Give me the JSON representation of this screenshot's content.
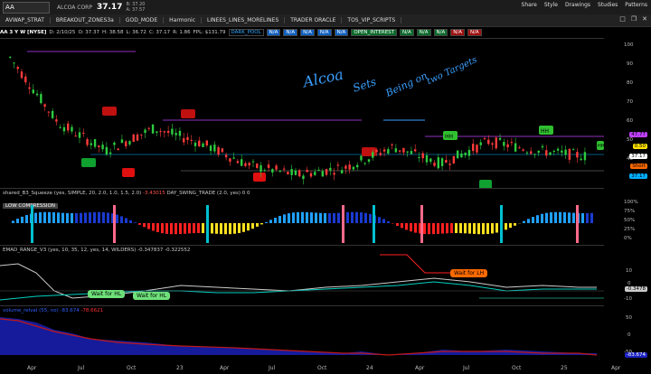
{
  "topbar": {
    "symbol": "AA",
    "company": "ALCOA CORP",
    "price": "37.17",
    "bid": "B: 37.20",
    "ask": "A: 37.57",
    "menu": [
      "Share",
      "Style",
      "Drawings",
      "Studies",
      "Patterns"
    ]
  },
  "studies_tabs": [
    "AVWAP_STRAT",
    "BREAKOUT_ZONES3a",
    "GOD_MODE",
    "Harmonic",
    "LINEES_LINES_MORELINES",
    "TRADER ORACLE",
    "TOS_VIP_SCRIPTS"
  ],
  "legend": {
    "title": "AA 3 Y W [NYSE]",
    "date": "D: 2/10/25",
    "o": "O: 37.37",
    "h": "H: 38.58",
    "l": "L: 36.72",
    "c": "C: 37.17",
    "r": "R: 1.86",
    "fpl": "FPL: $131.79",
    "dark_pool": "DARK_POOL",
    "na": "N/A",
    "open_interest": "OPEN_INTEREST"
  },
  "price_axis": {
    "ticks": [
      "100",
      "90",
      "80",
      "70",
      "60",
      "50",
      "40"
    ],
    "tags": [
      {
        "text": "47.77",
        "color": "#c040ff"
      },
      {
        "text": "0.50",
        "color": "#ffe000"
      },
      {
        "text": "37.17",
        "color": "#ffffff"
      },
      {
        "text": "Short",
        "color": "#ff6a00"
      },
      {
        "text": "37.17",
        "color": "#00b0ff"
      }
    ]
  },
  "annotations": {
    "handwriting": [
      "Alcoa",
      "Sets",
      "Being on",
      "two Targets"
    ],
    "hh": [
      "HH",
      "HH",
      "HH"
    ]
  },
  "squeeze": {
    "title": "shared_B3_Squeeze (yes, SIMPLE, 20, 2.0, 1.0, 1.5, 2.0)",
    "value": "-3.43015",
    "swing": "DAY_SWING_TRADE (2.0, yes)",
    "zero1": "0",
    "zero2": "0",
    "label": "LOW COMPRESSION",
    "ticks": [
      "100%",
      "75%",
      "50%",
      "25%",
      "0%"
    ]
  },
  "emad": {
    "title": "EMAD_RANGE_V3 (yes, 10, 35, 12, yes, 14, WILDERS)",
    "v1": "-0.347837",
    "v2": "-0.322552",
    "wait_lh": "Wait for LH",
    "wait_hl1": "Wait for HL",
    "wait_hl2": "Wait for HL",
    "ticks": [
      "10",
      "0",
      "-10"
    ],
    "tag": "-0.3478"
  },
  "lower": {
    "title": "volume_relval (55, no)",
    "v1": "-83.674",
    "v2": "-78.6621",
    "ticks": [
      "50",
      "0",
      "-50"
    ],
    "tag": "-83.674"
  },
  "xaxis": [
    "Apr",
    "Jul",
    "Oct",
    "23",
    "Apr",
    "Jul",
    "Oct",
    "24",
    "Apr",
    "Jul",
    "Oct",
    "25",
    "Apr"
  ],
  "chart_data": {
    "type": "line",
    "title": "AA 3 Y W [NYSE]",
    "x": [
      "2022-Apr",
      "2022-Jul",
      "2022-Oct",
      "2023-Jan",
      "2023-Apr",
      "2023-Jul",
      "2023-Oct",
      "2024-Jan",
      "2024-Apr",
      "2024-Jul",
      "2024-Oct",
      "2025-Jan",
      "2025-Feb"
    ],
    "series": [
      {
        "values": [
          90,
          55,
          40,
          52,
          44,
          32,
          27,
          31,
          42,
          33,
          45,
          40,
          37.17
        ]
      }
    ],
    "ylim": [
      20,
      100
    ]
  }
}
